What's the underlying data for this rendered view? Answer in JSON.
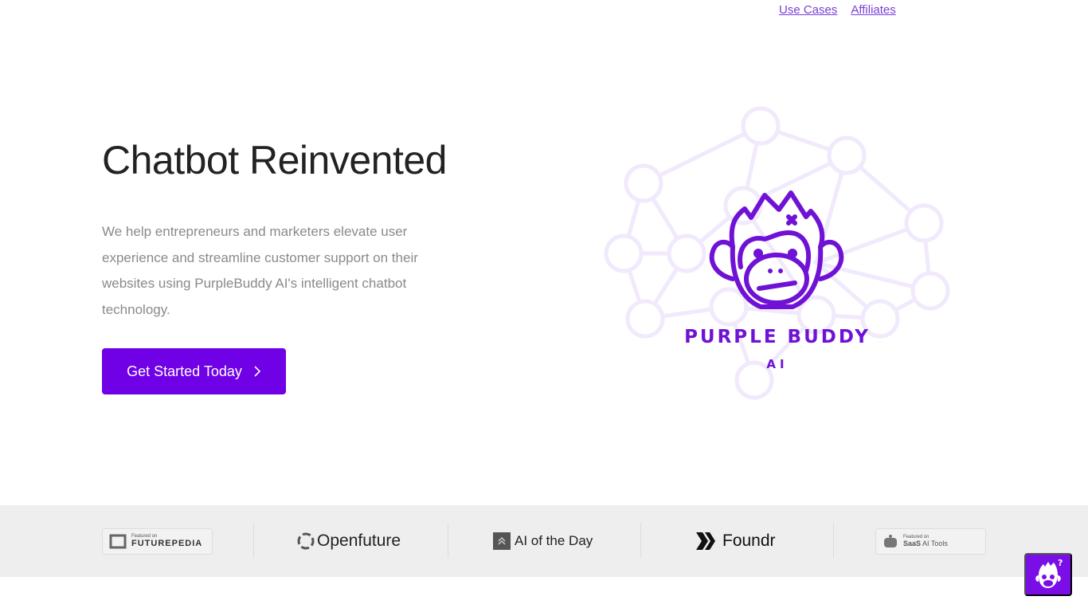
{
  "nav": {
    "links": [
      "Use Cases",
      "Affiliates"
    ]
  },
  "hero": {
    "title": "Chatbot Reinvented",
    "description": "We help entrepreneurs and marketers elevate user experience and streamline customer support on their websites using PurpleBuddy AI's intelligent chatbot technology.",
    "cta": "Get Started Today",
    "cta_icon": "chevron-right-icon"
  },
  "logo": {
    "line1": "PURPLE BUDDY",
    "line2": "AI"
  },
  "featured": [
    {
      "kicker": "Featured on",
      "name": "FUTUREPEDIA"
    },
    {
      "name": "Openfuture"
    },
    {
      "name": "AI of the Day"
    },
    {
      "name": "Foundr"
    },
    {
      "kicker": "Featured on",
      "name_bold": "SaaS",
      "name_rest": "AI Tools"
    }
  ],
  "colors": {
    "accent": "#7000e6",
    "network": "#f1e9fc",
    "logo_purple": "#6f12d6",
    "band": "#eeeeee"
  }
}
